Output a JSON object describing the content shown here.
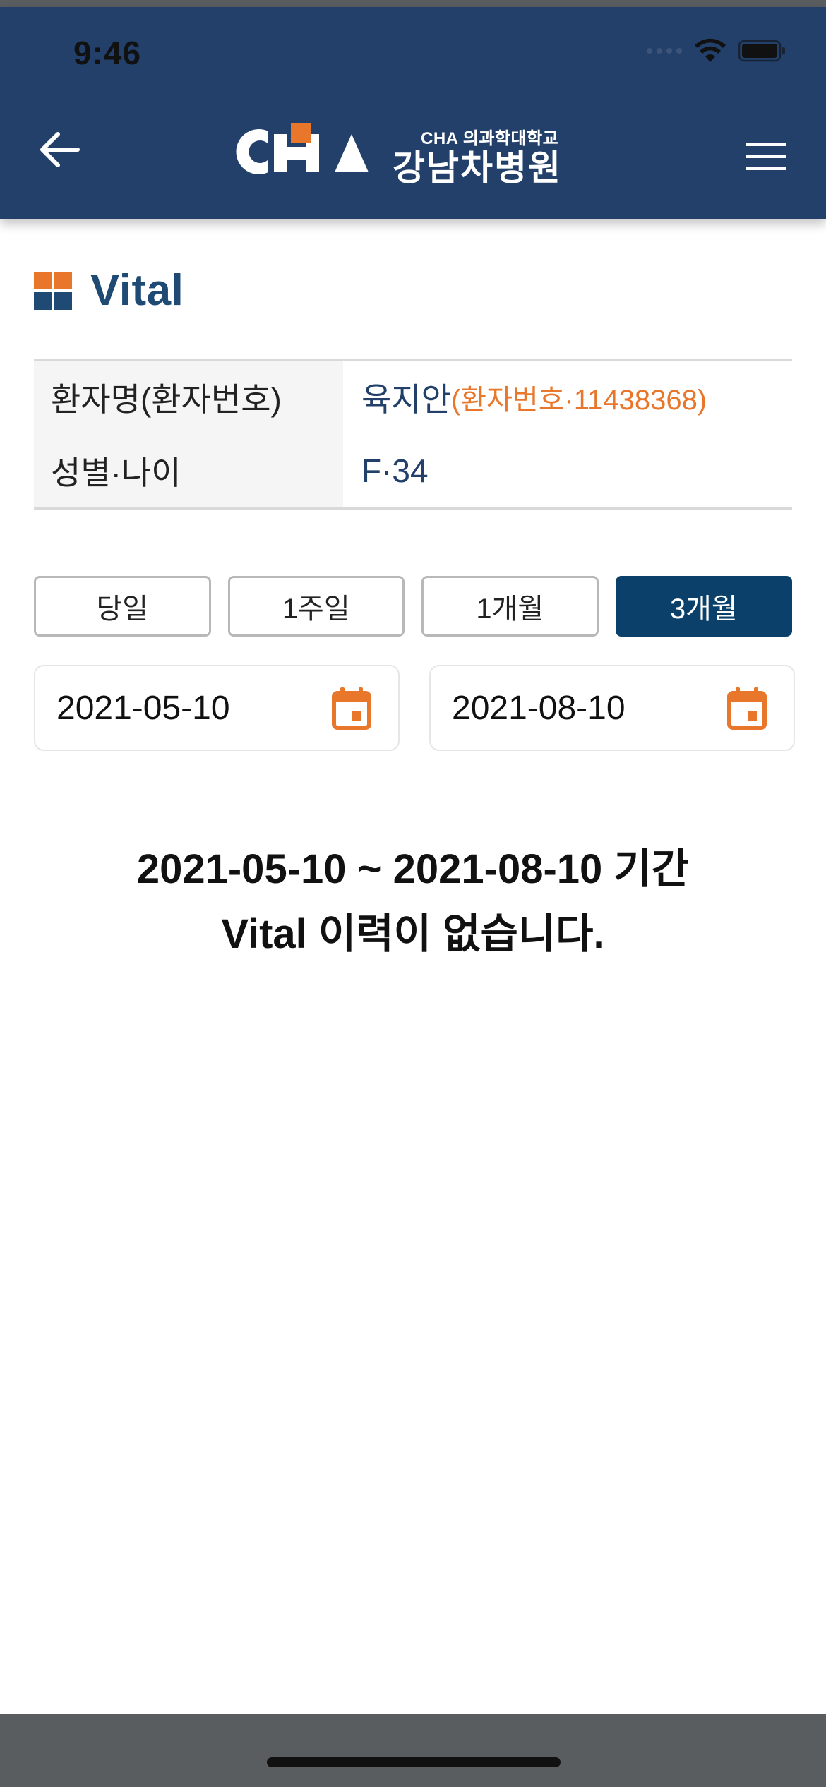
{
  "status_bar": {
    "time": "9:46"
  },
  "header": {
    "logo_text": "CHA",
    "logo_subtitle": "CHA 의과학대학교",
    "hospital_name": "강남차병원"
  },
  "page": {
    "title": "Vital"
  },
  "patient": {
    "name_label": "환자명(환자번호)",
    "name_value": "육지안",
    "number_value": "(환자번호·11438368)",
    "gender_age_label": "성별·나이",
    "gender_age_value": "F·34"
  },
  "periods": [
    {
      "label": "당일",
      "active": false
    },
    {
      "label": "1주일",
      "active": false
    },
    {
      "label": "1개월",
      "active": false
    },
    {
      "label": "3개월",
      "active": true
    }
  ],
  "date_range": {
    "start": "2021-05-10",
    "end": "2021-08-10"
  },
  "empty_message": {
    "line1": "2021-05-10 ~ 2021-08-10 기간",
    "line2": "Vital 이력이 없습니다."
  },
  "colors": {
    "header_bg": "#22406a",
    "accent_orange": "#e8762b",
    "navy": "#1f4a74",
    "active_button": "#0a4069"
  },
  "icons": {
    "back": "arrow-left-icon",
    "menu": "hamburger-menu-icon",
    "calendar": "calendar-icon",
    "title": "grid-squares-icon"
  }
}
